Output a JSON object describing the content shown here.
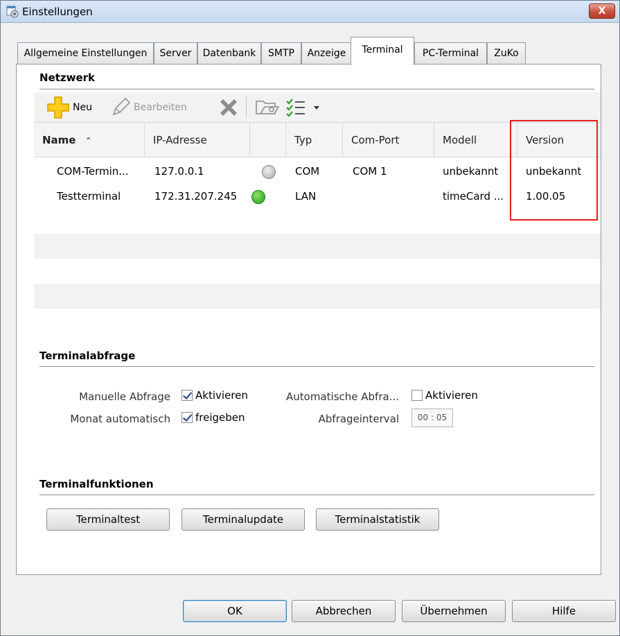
{
  "window": {
    "title": "Einstellungen",
    "close_label": "X"
  },
  "tabs": [
    {
      "label": "Allgemeine Einstellungen"
    },
    {
      "label": "Server"
    },
    {
      "label": "Datenbank"
    },
    {
      "label": "SMTP"
    },
    {
      "label": "Anzeige"
    },
    {
      "label": "Terminal",
      "active": true
    },
    {
      "label": "PC-Terminal"
    },
    {
      "label": "ZuKo"
    }
  ],
  "netzwerk": {
    "title": "Netzwerk",
    "toolbar": {
      "new_label": "Neu",
      "edit_label": "Bearbeiten"
    },
    "columns": [
      "Name",
      "IP-Adresse",
      "",
      "Typ",
      "Com-Port",
      "Modell",
      "Version"
    ],
    "sort_indicator": "⌃",
    "rows": [
      {
        "name": "COM-Termin...",
        "ip": "127.0.0.1",
        "status": "grey",
        "typ": "COM",
        "port": "COM 1",
        "modell": "unbekannt",
        "version": "unbekannt"
      },
      {
        "name": "Testterminal",
        "ip": "172.31.207.245",
        "status": "green",
        "typ": "LAN",
        "port": "",
        "modell": "timeCard ...",
        "version": "1.00.05"
      }
    ]
  },
  "terminalabfrage": {
    "title": "Terminalabfrage",
    "manuelle_label": "Manuelle Abfrage",
    "manuelle_check": "Aktivieren",
    "manuelle_checked": true,
    "auto_label": "Automatische Abfra...",
    "auto_check": "Aktivieren",
    "auto_checked": false,
    "monat_label": "Monat automatisch",
    "monat_check": "freigeben",
    "monat_checked": true,
    "interval_label": "Abfrageinterval",
    "interval_value": "00 : 05"
  },
  "terminalfunktionen": {
    "title": "Terminalfunktionen",
    "buttons": [
      "Terminaltest",
      "Terminalupdate",
      "Terminalstatistik"
    ]
  },
  "footer": {
    "ok": "OK",
    "cancel": "Abbrechen",
    "apply": "Übernehmen",
    "help": "Hilfe"
  },
  "colors": {
    "highlight": "#e41d1d",
    "status_green": "#27a51c",
    "status_grey": "#c4c4c4"
  }
}
